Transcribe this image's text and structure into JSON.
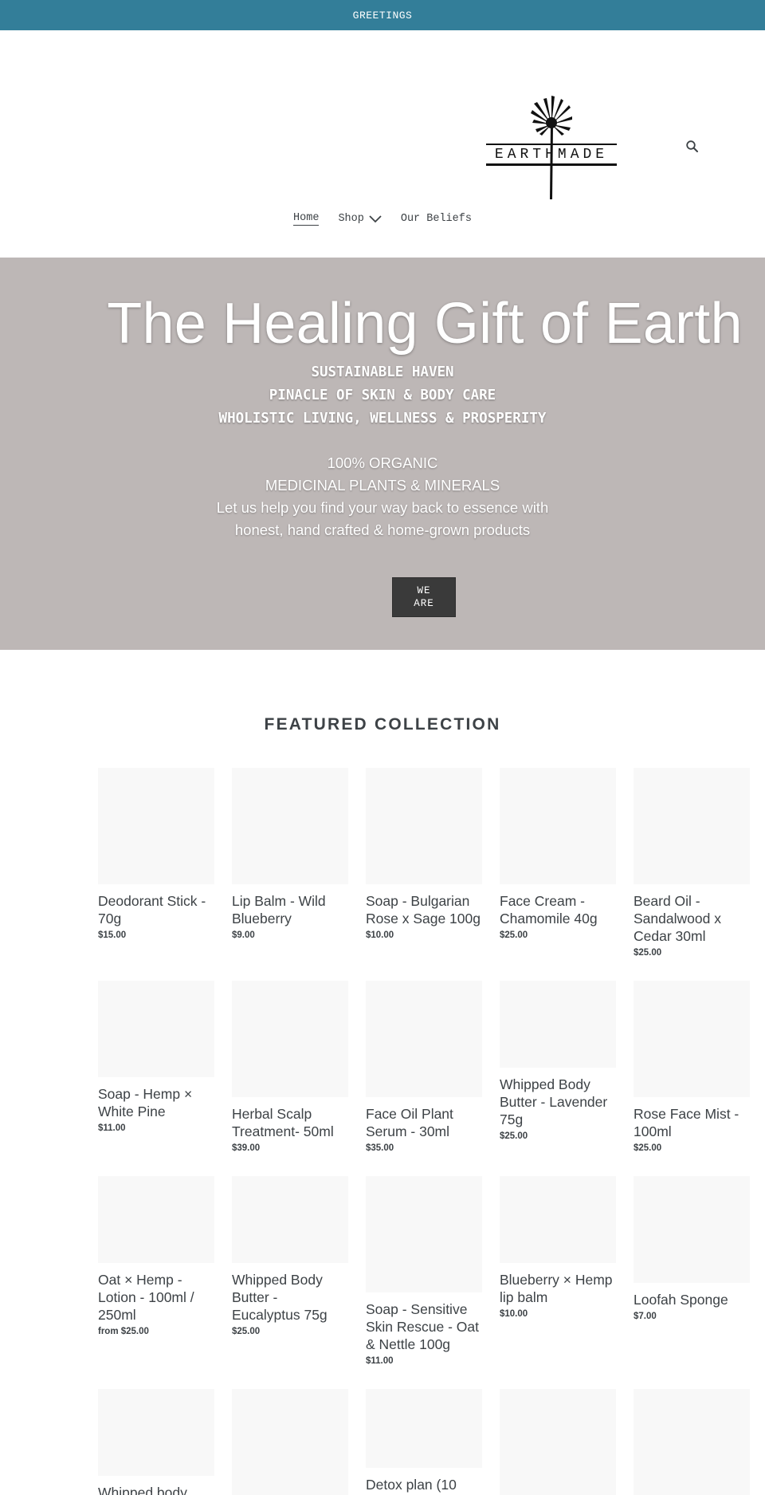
{
  "announcement": {
    "text": "GREETINGS"
  },
  "header": {
    "logo_text": "EARTHMADE"
  },
  "nav": {
    "items": [
      {
        "label": "Home",
        "active": true
      },
      {
        "label": "Shop",
        "has_dropdown": true
      },
      {
        "label": "Our Beliefs"
      }
    ]
  },
  "hero": {
    "title": "The Healing Gift of Earth",
    "subtitle_lines": [
      "SUSTAINABLE HAVEN",
      "PINACLE OF SKIN & BODY CARE",
      "WHOLISTIC LIVING, WELLNESS & PROSPERITY"
    ],
    "body_lines": [
      "100% ORGANIC",
      "MEDICINAL PLANTS & MINERALS",
      "Let us help you find your way back to essence with",
      "honest, hand crafted & home-grown products"
    ],
    "button_label": "WE\nARE",
    "background_color": "#bdb7b6"
  },
  "featured": {
    "title": "FEATURED COLLECTION",
    "products": [
      {
        "name": "Deodorant Stick - 70g",
        "price": "$15.00"
      },
      {
        "name": "Lip Balm - Wild Blueberry",
        "price": "$9.00"
      },
      {
        "name": "Soap - Bulgarian Rose x Sage 100g",
        "price": "$10.00"
      },
      {
        "name": "Face Cream - Chamomile 40g",
        "price": "$25.00"
      },
      {
        "name": "Beard Oil - Sandalwood x Cedar 30ml",
        "price": "$25.00"
      },
      {
        "name": "Soap - Hemp × White Pine",
        "price": "$11.00"
      },
      {
        "name": "Herbal Scalp Treatment- 50ml",
        "price": "$39.00"
      },
      {
        "name": "Face Oil Plant Serum - 30ml",
        "price": "$35.00"
      },
      {
        "name": "Whipped Body Butter - Lavender 75g",
        "price": "$25.00"
      },
      {
        "name": "Rose Face Mist - 100ml",
        "price": "$25.00"
      },
      {
        "name": "Oat × Hemp - Lotion - 100ml / 250ml",
        "price": "from $25.00"
      },
      {
        "name": "Whipped Body Butter - Eucalyptus 75g",
        "price": "$25.00"
      },
      {
        "name": "Soap - Sensitive Skin Rescue - Oat & Nettle 100g",
        "price": "$11.00"
      },
      {
        "name": "Blueberry × Hemp lip balm",
        "price": "$10.00"
      },
      {
        "name": "Loofah Sponge",
        "price": "$7.00"
      },
      {
        "name": "Whipped body",
        "price": ""
      },
      {
        "name": "",
        "price": ""
      },
      {
        "name": "Detox plan (10",
        "price": ""
      },
      {
        "name": "",
        "price": ""
      },
      {
        "name": "",
        "price": ""
      }
    ]
  },
  "colors": {
    "announcement_bg": "#337e99",
    "hero_bg": "#bdb7b6",
    "button_bg": "#3a3a3a",
    "text": "#3d4246",
    "placeholder": "#f8f8f8"
  }
}
